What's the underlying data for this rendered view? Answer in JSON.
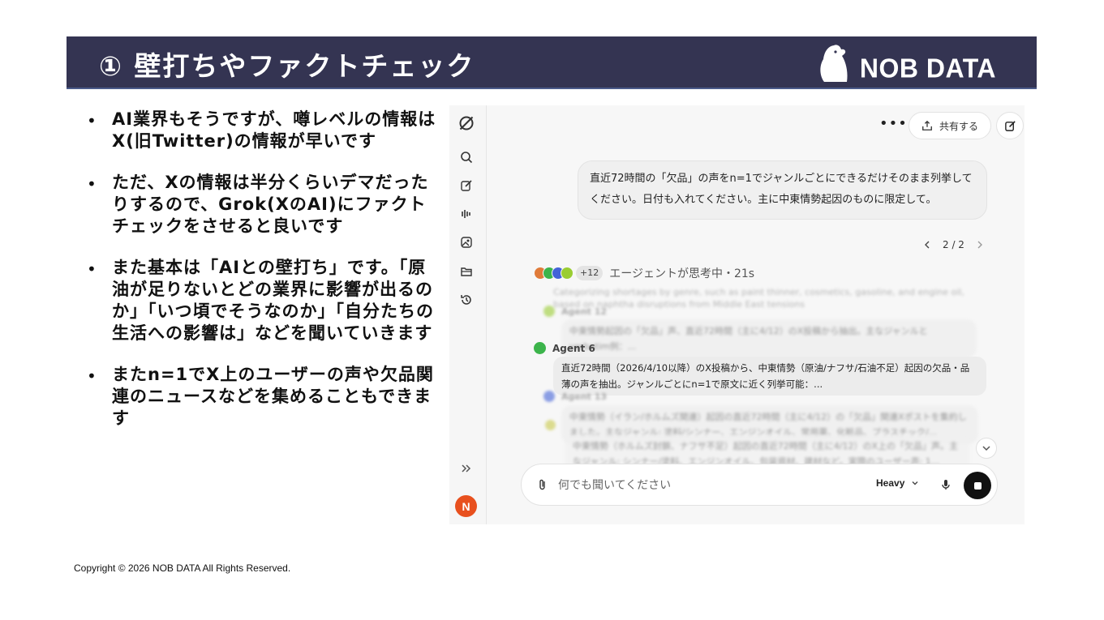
{
  "slide": {
    "title": "① 壁打ちやファクトチェック",
    "brand": "NOB DATA",
    "copyright": "Copyright © 2026 NOB DATA All Rights Reserved.",
    "bullet_symbol": "•",
    "bullets": [
      "AI業界もそうですが、噂レベルの情報はX(旧Twitter)の情報が早いです",
      "ただ、Xの情報は半分くらいデマだったりするので、Grok(XのAI)にファクトチェックをさせると良いです",
      "また基本は「AIとの壁打ち」です。「原油が足りないとどの業界に影響が出るのか」「いつ頃でそうなのか」「自分たちの生活への影響は」などを聞いていきます",
      "またn=1でX上のユーザーの声や欠品関連のニュースなどを集めることもできます"
    ]
  },
  "app": {
    "share_label": "共有する",
    "more_label": "•••",
    "user_message": "直近72時間の「欠品」の声をn=1でジャンルごとにできるだけそのまま列挙してください。日付も入れてください。主に中東情勢起因のものに限定して。",
    "pager": "2 / 2",
    "agent_count": "+12",
    "thinking_status": "エージェントが思考中・21s",
    "faded_step": "Categorizing shortages by genre, such as paint thinner, cosmetics, gasoline, and engine oil, based on naphtha disruptions from Middle East tensions",
    "agents": [
      {
        "name": "Agent 12",
        "text": "中東情勢起因の「欠品」声、直近72時間（主に4/12）のX投稿から抽出。主なジャンルと verbatim例：..."
      },
      {
        "name": "Agent 6",
        "text": "直近72時間（2026/4/10以降）のX投稿から、中東情勢（原油/ナフサ/石油不足）起因の欠品・品薄の声を抽出。ジャンルごとにn=1で原文に近く列挙可能：..."
      },
      {
        "name": "Agent 13",
        "text": "中東情勢（イラン/ホルムズ関連）起因の直近72時間（主に4/12）の「欠品」関連Xポストを集約しました。主なジャンル: 塗料/シンナー、エンジンオイル、常用薬、化粧品、プラスチック/..."
      },
      {
        "name": "",
        "text": "中東情勢（ホルムズ封鎖、ナフサ不足）起因の直近72時間（主に4/12）のX上の「欠品」声。主なジャンル: シンナー/塗料、エンジンオイル、包装資材、建材など。実際のユーザー声: 1..."
      }
    ],
    "composer_placeholder": "何でも聞いてください",
    "model": "Heavy",
    "avatar_initial": "N",
    "colors": {
      "header_bg": "#343452",
      "avatar": "#e8501e",
      "agent_dots": [
        "#e07b39",
        "#3cb44b",
        "#4363d8",
        "#9acd32"
      ]
    }
  }
}
